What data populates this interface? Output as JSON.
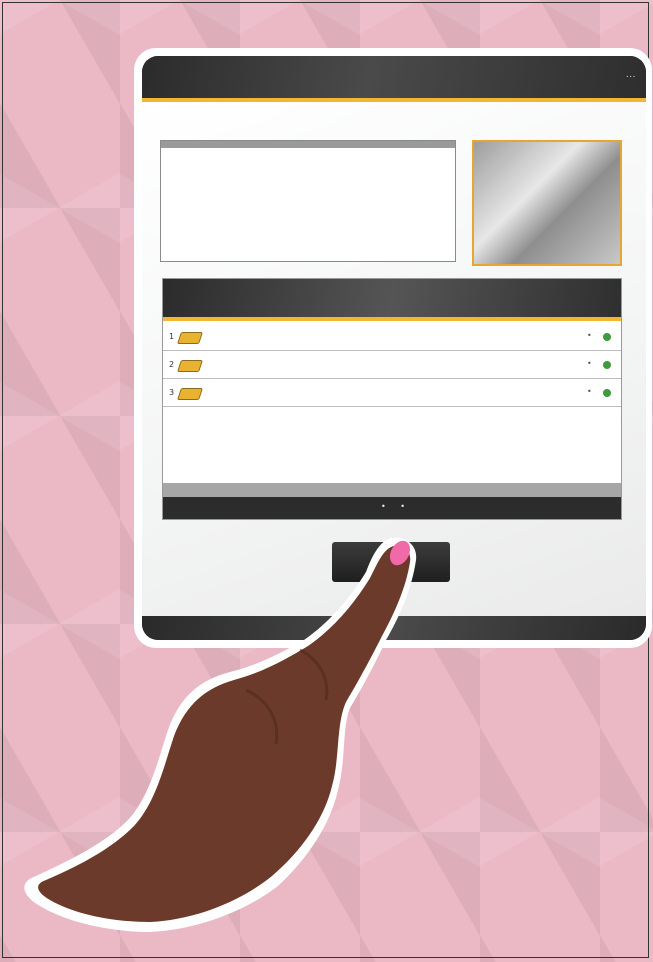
{
  "status_bar": {
    "text": "..."
  },
  "screen": {
    "title": ""
  },
  "info_panel": {
    "header": "",
    "lines": [
      "",
      "",
      "",
      ""
    ]
  },
  "list": {
    "title": "",
    "column_label": "",
    "rows": [
      {
        "index": "1",
        "name": "",
        "status": "",
        "mark": "•"
      },
      {
        "index": "2",
        "name": "",
        "status": "",
        "mark": "•"
      },
      {
        "index": "3",
        "name": "",
        "status": "",
        "mark": "•"
      }
    ],
    "pager": "• •"
  },
  "action_button": {
    "label": ""
  },
  "colors": {
    "accent": "#f2b630",
    "status_green": "#3e9a3c",
    "nail": "#f06aa8",
    "skin": "#6b3a2a",
    "background": "#ebb8c6"
  }
}
